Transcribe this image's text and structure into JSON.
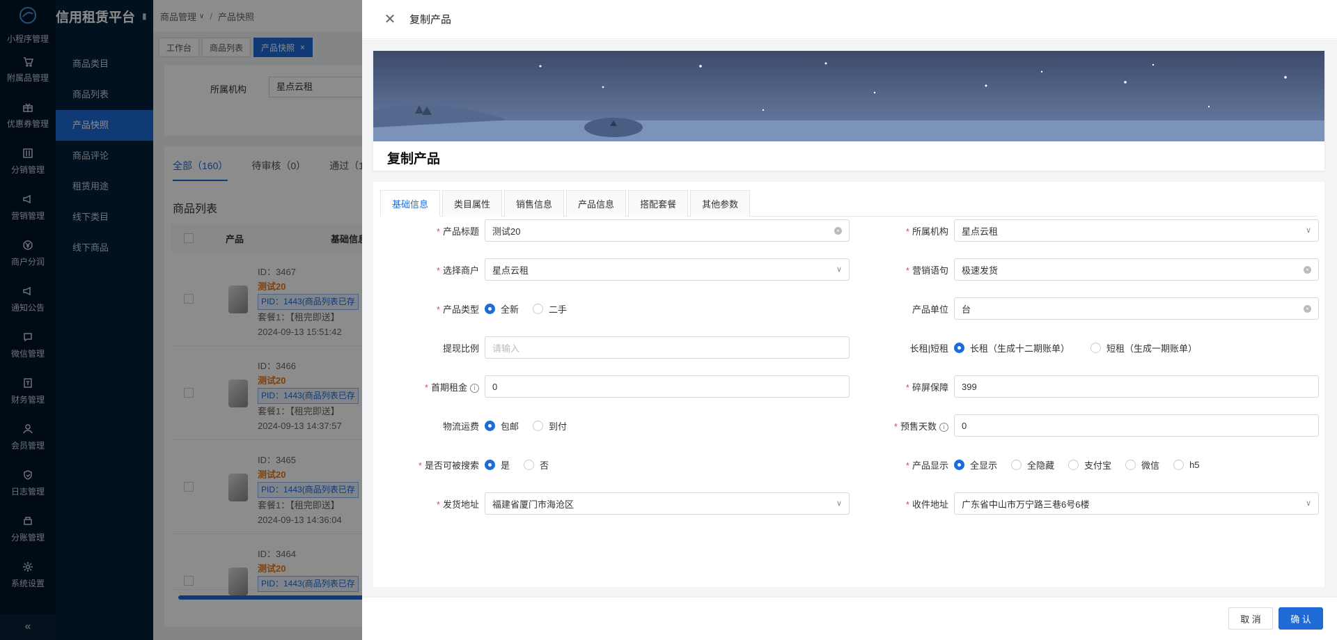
{
  "app": {
    "title": "信用租赁平台"
  },
  "rail": {
    "top_label": "小程序管理",
    "items": [
      {
        "label": "附属品管理",
        "icon": "cart-icon"
      },
      {
        "label": "优惠券管理",
        "icon": "gift-icon"
      },
      {
        "label": "分销管理",
        "icon": "sliders-icon"
      },
      {
        "label": "营销管理",
        "icon": "megaphone-icon"
      },
      {
        "label": "商户分润",
        "icon": "yen-icon"
      },
      {
        "label": "通知公告",
        "icon": "notice-icon"
      },
      {
        "label": "微信管理",
        "icon": "chat-icon"
      },
      {
        "label": "财务管理",
        "icon": "finance-icon"
      },
      {
        "label": "会员管理",
        "icon": "user-icon"
      },
      {
        "label": "日志管理",
        "icon": "shield-icon"
      },
      {
        "label": "分账管理",
        "icon": "split-icon"
      },
      {
        "label": "系统设置",
        "icon": "gear-icon"
      }
    ],
    "collapse_glyph": "«"
  },
  "submenu": {
    "items": [
      "商品类目",
      "商品列表",
      "产品快照",
      "商品评论",
      "租赁用途",
      "线下类目",
      "线下商品"
    ],
    "active_index": 2
  },
  "breadcrumb": {
    "parent": "商品管理",
    "current": "产品快照"
  },
  "page_tabs": [
    {
      "label": "工作台"
    },
    {
      "label": "商品列表"
    },
    {
      "label": "产品快照",
      "active": true
    }
  ],
  "filter": {
    "label": "所属机构",
    "value": "星点云租"
  },
  "status_tabs": [
    "全部（160）",
    "待审核（0）",
    "通过（1"
  ],
  "list": {
    "title": "商品列表",
    "col_product": "产品",
    "col_base": "基础信息",
    "rows": [
      {
        "id": "ID：3467",
        "name": "测试20",
        "pid": "PID：1443(商品列表已存",
        "plan": "套餐1：【租完即送】",
        "time": "2024-09-13 15:51:42"
      },
      {
        "id": "ID：3466",
        "name": "测试20",
        "pid": "PID：1443(商品列表已存",
        "plan": "套餐1：【租完即送】",
        "time": "2024-09-13 14:37:57"
      },
      {
        "id": "ID：3465",
        "name": "测试20",
        "pid": "PID：1443(商品列表已存",
        "plan": "套餐1：【租完即送】",
        "time": "2024-09-13 14:36:04"
      },
      {
        "id": "ID：3464",
        "name": "测试20",
        "pid": "PID：1443(商品列表已存",
        "plan": "",
        "time": ""
      }
    ]
  },
  "drawer": {
    "header_title": "复制产品",
    "banner_title": "复制产品",
    "tabs": [
      "基础信息",
      "类目属性",
      "销售信息",
      "产品信息",
      "搭配套餐",
      "其他参数"
    ],
    "active_tab": 0,
    "fields": {
      "title": {
        "label": "产品标题",
        "value": "测试20"
      },
      "org": {
        "label": "所属机构",
        "value": "星点云租"
      },
      "merchant": {
        "label": "选择商户",
        "value": "星点云租"
      },
      "slogan": {
        "label": "营销语句",
        "value": "极速发货"
      },
      "ptype": {
        "label": "产品类型",
        "options": [
          "全新",
          "二手"
        ],
        "selected": "全新"
      },
      "unit": {
        "label": "产品单位",
        "value": "台"
      },
      "withdraw": {
        "label": "提现比例",
        "placeholder": "请输入"
      },
      "lease": {
        "label": "长租|短租",
        "options": [
          "长租（生成十二期账单）",
          "短租（生成一期账单）"
        ],
        "selected": "长租（生成十二期账单）"
      },
      "first_rent": {
        "label": "首期租金",
        "value": "0"
      },
      "screen": {
        "label": "碎屏保障",
        "value": "399"
      },
      "logistics": {
        "label": "物流运费",
        "options": [
          "包邮",
          "到付"
        ],
        "selected": "包邮"
      },
      "presale": {
        "label": "预售天数",
        "value": "0"
      },
      "searchable": {
        "label": "是否可被搜索",
        "options": [
          "是",
          "否"
        ],
        "selected": "是"
      },
      "display": {
        "label": "产品显示",
        "options": [
          "全显示",
          "全隐藏",
          "支付宝",
          "微信",
          "h5"
        ],
        "selected": "全显示"
      },
      "ship_addr": {
        "label": "发货地址",
        "value": "福建省厦门市海沧区"
      },
      "recv_addr": {
        "label": "收件地址",
        "value": "广东省中山市万宁路三巷6号6楼"
      }
    },
    "cancel_label": "取 消",
    "ok_label": "确 认"
  },
  "colors": {
    "primary": "#1e6bd6",
    "sidebar": "#001529",
    "required": "#e5484d",
    "name_orange": "#e8771a"
  }
}
